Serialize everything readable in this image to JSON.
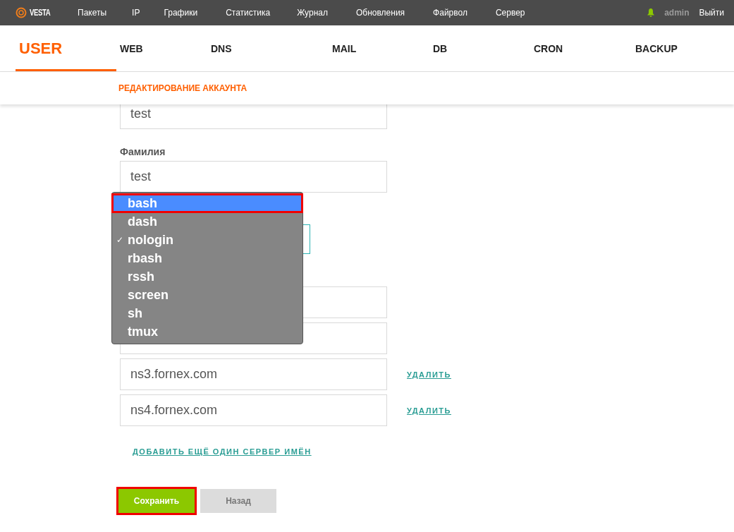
{
  "topbar": {
    "logo": "VESTA",
    "menu": [
      "Пакеты",
      "IP",
      "Графики",
      "Статистика",
      "Журнал",
      "Обновления",
      "Файрвол",
      "Сервер"
    ],
    "user": "admin",
    "logout": "Выйти"
  },
  "tabs": [
    {
      "label": "USER",
      "selected": true
    },
    {
      "label": "WEB",
      "selected": false
    },
    {
      "label": "DNS",
      "selected": false
    },
    {
      "label": "MAIL",
      "selected": false
    },
    {
      "label": "DB",
      "selected": false
    },
    {
      "label": "CRON",
      "selected": false
    },
    {
      "label": "BACKUP",
      "selected": false
    }
  ],
  "subheader": "РЕДАКТИРОВАНИЕ АККАУНТА",
  "form": {
    "first_name": "test",
    "last_name_label": "Фамилия",
    "last_name": "test",
    "nameservers": [
      {
        "value": "ns3.fornex.com",
        "remove": "УДАЛИТЬ"
      },
      {
        "value": "ns4.fornex.com",
        "remove": "УДАЛИТЬ"
      }
    ],
    "add_nameserver": "ДОБАВИТЬ ЕЩЁ ОДИН СЕРВЕР ИМЁН"
  },
  "check_mark": "✓",
  "shell_menu": [
    {
      "label": "bash",
      "checked": false,
      "selected": true,
      "highlighted": true
    },
    {
      "label": "dash",
      "checked": false,
      "selected": false,
      "highlighted": false
    },
    {
      "label": "nologin",
      "checked": true,
      "selected": false,
      "highlighted": false
    },
    {
      "label": "rbash",
      "checked": false,
      "selected": false,
      "highlighted": false
    },
    {
      "label": "rssh",
      "checked": false,
      "selected": false,
      "highlighted": false
    },
    {
      "label": "screen",
      "checked": false,
      "selected": false,
      "highlighted": false
    },
    {
      "label": "sh",
      "checked": false,
      "selected": false,
      "highlighted": false
    },
    {
      "label": "tmux",
      "checked": false,
      "selected": false,
      "highlighted": false
    }
  ],
  "buttons": [
    {
      "label": "Сохранить",
      "kind": "primary",
      "highlighted": true
    },
    {
      "label": "Назад",
      "kind": "secondary",
      "highlighted": false
    }
  ]
}
